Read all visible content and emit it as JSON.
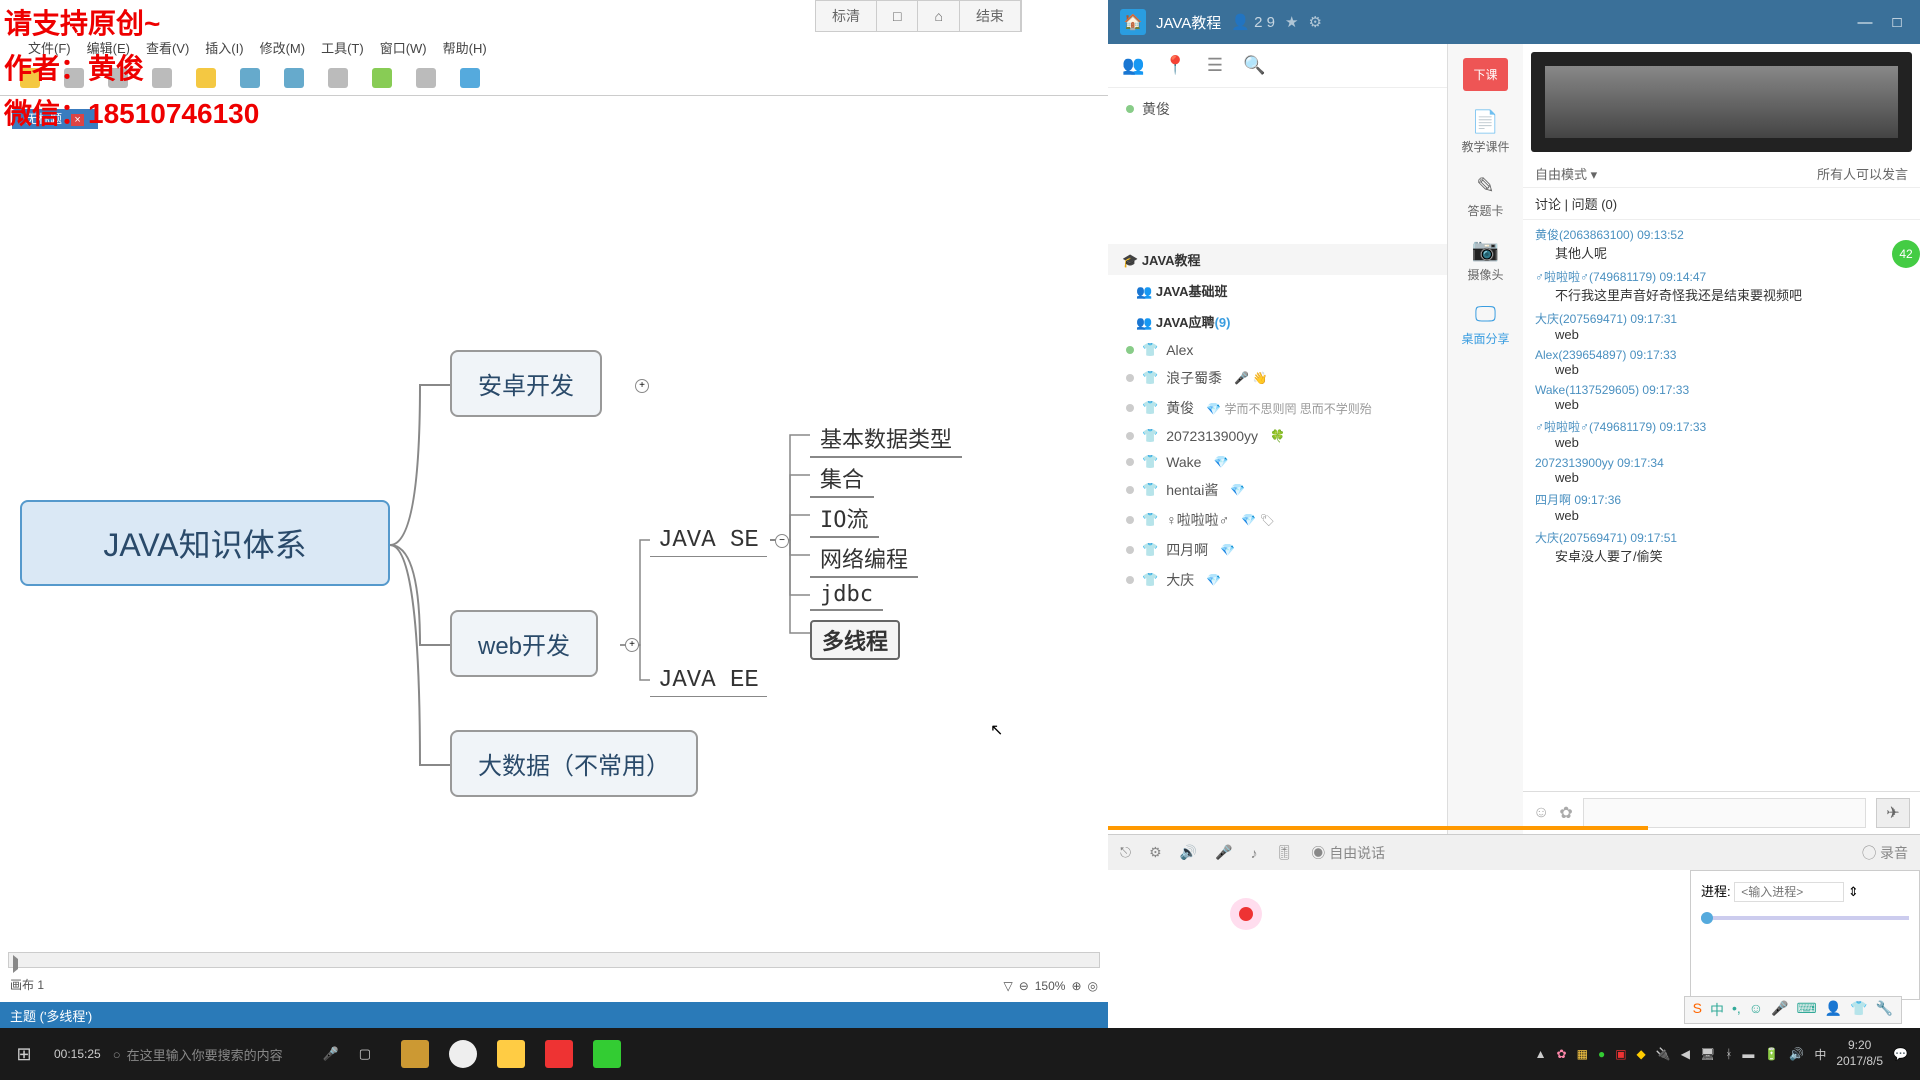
{
  "watermark": {
    "line1": "请支持原创~",
    "line2": "作者：黄俊",
    "line3": "微信：18510746130"
  },
  "topControls": [
    "标清",
    "□",
    "⌂",
    "结束"
  ],
  "menubar": [
    "文件(F)",
    "编辑(E)",
    "查看(V)",
    "插入(I)",
    "修改(M)",
    "工具(T)",
    "窗口(W)",
    "帮助(H)"
  ],
  "tab": {
    "label": "无标题",
    "close": "×"
  },
  "mindmap": {
    "root": "JAVA知识体系",
    "branches": {
      "android": "安卓开发",
      "web": "web开发",
      "bigdata": "大数据（不常用）"
    },
    "mids": {
      "se": "JAVA SE",
      "ee": "JAVA EE"
    },
    "leaves": [
      "基本数据类型",
      "集合",
      "IO流",
      "网络编程",
      "jdbc",
      "多线程"
    ]
  },
  "footer": {
    "canvas": "画布 1",
    "status": "主题 ('多线程')",
    "zoom": "150%"
  },
  "qq": {
    "title": "JAVA教程",
    "titleBadge": "2 9",
    "modeLabel": "自由模式",
    "modeRight": "所有人可以发言",
    "chatTabs": "讨论 | 问题  (0)",
    "actions": {
      "end": "下课",
      "courseware": "教学课件",
      "answerCard": "答题卡",
      "camera": "摄像头",
      "share": "桌面分享"
    },
    "bottom": {
      "freeTalk": "自由说话",
      "record": "录音"
    },
    "groups": {
      "main": "JAVA教程",
      "basic": "JAVA基础班",
      "recruit": "JAVA应聘",
      "recruitCount": "(9)"
    },
    "owner": "黄俊",
    "members": [
      {
        "name": "Alex",
        "suffix": ""
      },
      {
        "name": "浪子蜀黍",
        "suffix": "🎤 👋"
      },
      {
        "name": "黄俊",
        "suffix": "💎 学而不思则罔 思而不学则殆"
      },
      {
        "name": "2072313900yy",
        "suffix": "🍀"
      },
      {
        "name": "Wake",
        "suffix": "💎"
      },
      {
        "name": "hentai酱",
        "suffix": "💎"
      },
      {
        "name": "♀啦啦啦♂",
        "suffix": "💎 🏷"
      },
      {
        "name": "四月啊",
        "suffix": "💎"
      },
      {
        "name": "大庆",
        "suffix": "💎"
      }
    ],
    "messages": [
      {
        "who": "黄俊(2063863100) 09:13:52",
        "txt": "其他人呢"
      },
      {
        "who": "♂啦啦啦♂(749681179) 09:14:47",
        "txt": "不行我这里声音好奇怪我还是结束要视频吧"
      },
      {
        "who": "大庆(207569471) 09:17:31",
        "txt": "web"
      },
      {
        "who": "Alex(239654897) 09:17:33",
        "txt": "web"
      },
      {
        "who": "Wake(1137529605) 09:17:33",
        "txt": "web"
      },
      {
        "who": "♂啦啦啦♂(749681179) 09:17:33",
        "txt": "web"
      },
      {
        "who": "2072313900yy 09:17:34",
        "txt": "web"
      },
      {
        "who": "四月啊 09:17:36",
        "txt": "web"
      },
      {
        "who": "大庆(207569471) 09:17:51",
        "txt": "安卓没人要了/偷笑"
      }
    ],
    "bubble": "42"
  },
  "proc": {
    "label": "进程:",
    "placeholder": "<输入进程>"
  },
  "taskbar": {
    "rectime": "00:15:25",
    "searchPlaceholder": "在这里输入你要搜索的内容",
    "time": "9:20",
    "date": "2017/8/5"
  }
}
